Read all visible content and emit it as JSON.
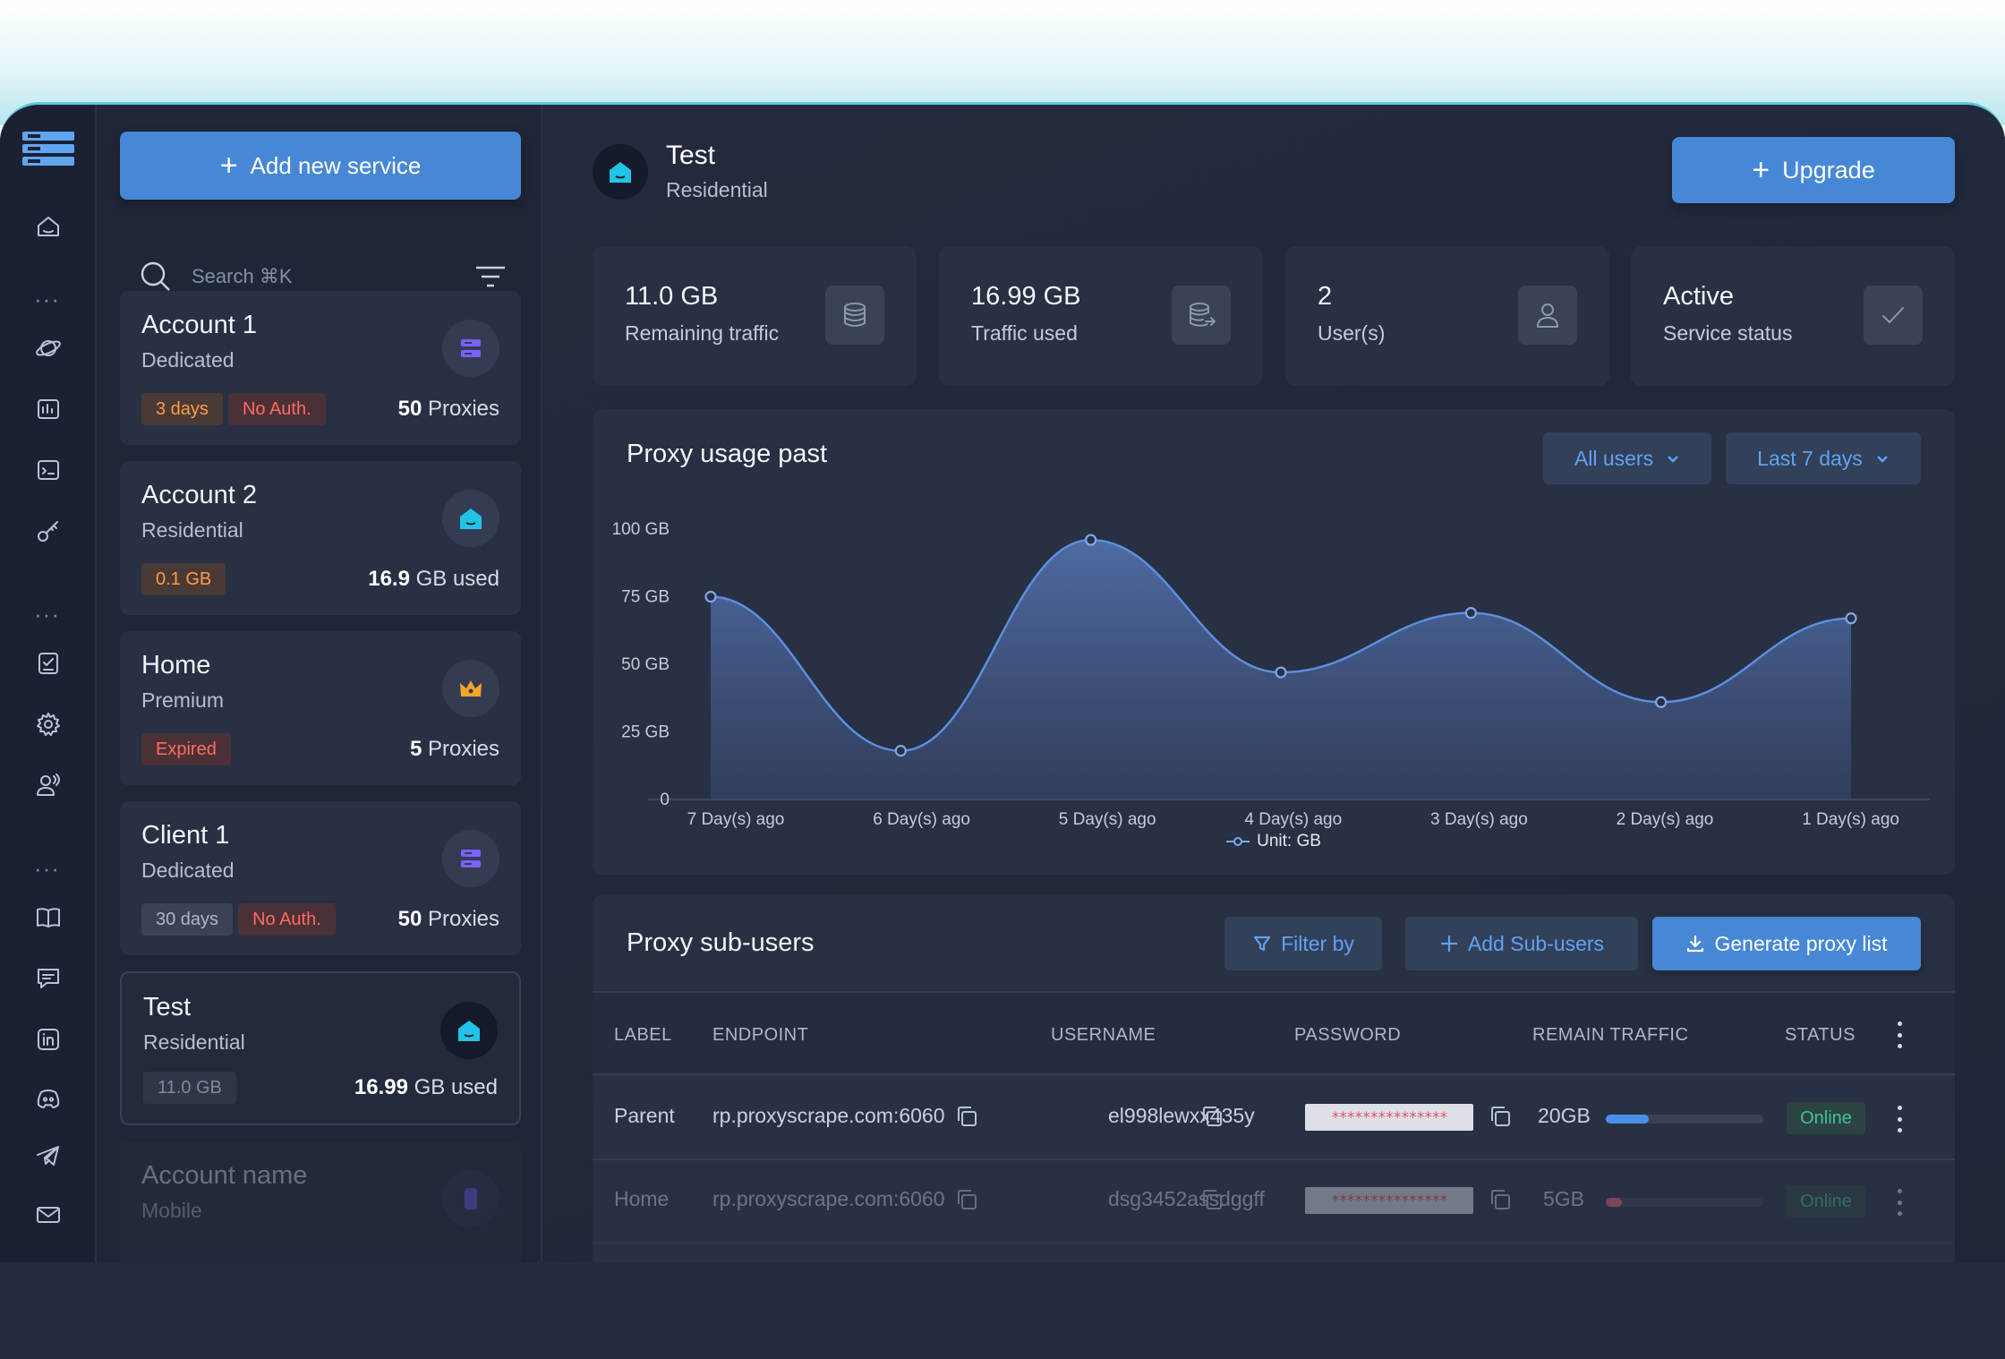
{
  "sidebar": {
    "add_service_label": "Add new service",
    "search_placeholder": "Search ⌘K",
    "cards": [
      {
        "title": "Account 1",
        "subtitle": "Dedicated",
        "tags": [
          {
            "text": "3 days",
            "tone": "orange"
          },
          {
            "text": "No Auth.",
            "tone": "red"
          }
        ],
        "value": "50",
        "unit": " Proxies",
        "icon": "server-icon",
        "icon_color": "#7b61ff"
      },
      {
        "title": "Account 2",
        "subtitle": "Residential",
        "tags": [
          {
            "text": "0.1 GB",
            "tone": "orange"
          }
        ],
        "value": "16.9",
        "unit": " GB used",
        "icon": "house-icon",
        "icon_color": "#22c4e6"
      },
      {
        "title": "Home",
        "subtitle": "Premium",
        "tags": [
          {
            "text": "Expired",
            "tone": "red"
          }
        ],
        "value": "5",
        "unit": " Proxies",
        "icon": "crown-icon",
        "icon_color": "#f5a524"
      },
      {
        "title": "Client 1",
        "subtitle": "Dedicated",
        "tags": [
          {
            "text": "30 days",
            "tone": "grey"
          },
          {
            "text": "No Auth.",
            "tone": "red"
          }
        ],
        "value": "50",
        "unit": " Proxies",
        "icon": "server-icon",
        "icon_color": "#7b61ff"
      },
      {
        "title": "Test",
        "subtitle": "Residential",
        "tags": [
          {
            "text": "11.0 GB",
            "tone": "dim"
          }
        ],
        "value": "16.99",
        "unit": " GB used",
        "icon": "house-icon",
        "icon_color": "#22c4e6"
      },
      {
        "title": "Account name",
        "subtitle": "Mobile",
        "tags": [],
        "value": "",
        "unit": "",
        "icon": "phone-icon",
        "icon_color": "#7b61ff"
      }
    ]
  },
  "header": {
    "service_title": "Test",
    "service_type": "Residential",
    "upgrade_label": "Upgrade"
  },
  "stats": [
    {
      "value": "11.0 GB",
      "label": "Remaining traffic",
      "icon": "database-icon"
    },
    {
      "value": "16.99 GB",
      "label": "Traffic used",
      "icon": "database-export-icon"
    },
    {
      "value": "2",
      "label": "User(s)",
      "icon": "user-icon"
    },
    {
      "value": "Active",
      "label": "Service status",
      "icon": "check-icon"
    }
  ],
  "usage": {
    "title": "Proxy usage past",
    "users_filter": "All users",
    "range_filter": "Last 7 days"
  },
  "chart_data": {
    "type": "area",
    "categories": [
      "7 Day(s) ago",
      "6 Day(s) ago",
      "5 Day(s) ago",
      "4 Day(s) ago",
      "3 Day(s) ago",
      "2 Day(s) ago",
      "1 Day(s) ago"
    ],
    "values": [
      75,
      18,
      96,
      47,
      69,
      36,
      67
    ],
    "y_ticks": [
      "0",
      "25 GB",
      "50 GB",
      "75 GB",
      "100 GB"
    ],
    "ylim": [
      0,
      100
    ],
    "legend": "Unit: GB",
    "legend_position": "bottom-center",
    "grid": false,
    "color": "#5b8fe0"
  },
  "subusers": {
    "title": "Proxy sub-users",
    "filter_label": "Filter by",
    "add_label": "Add Sub-users",
    "generate_label": "Generate proxy list",
    "columns": [
      "LABEL",
      "ENDPOINT",
      "USERNAME",
      "PASSWORD",
      "REMAIN TRAFFIC",
      "STATUS"
    ],
    "rows": [
      {
        "label": "Parent",
        "endpoint": "rp.proxyscrape.com:6060",
        "username": "el998lewxx435y",
        "password": "***************",
        "traffic": "20GB",
        "traffic_fraction": 0.27,
        "bar_color": "#4a8fe7",
        "status": "Online"
      },
      {
        "label": "Home",
        "endpoint": "rp.proxyscrape.com:6060",
        "username": "dsg3452assdggff",
        "password": "***************",
        "traffic": "5GB",
        "traffic_fraction": 0.1,
        "bar_color": "#f0646e",
        "status": "Online"
      }
    ]
  }
}
